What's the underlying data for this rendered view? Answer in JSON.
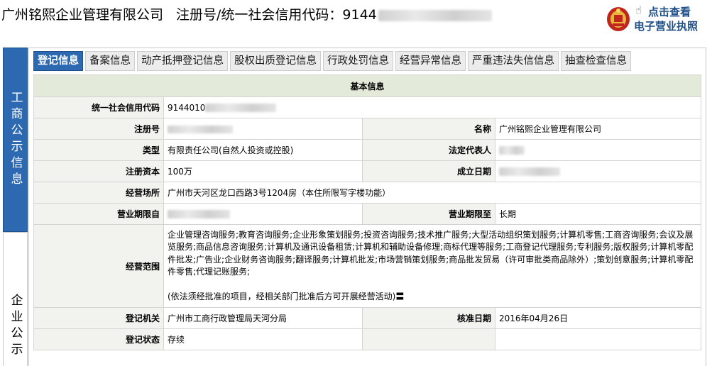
{
  "header": {
    "company_name": "广州铭熙企业管理有限公司",
    "reg_label": "注册号/统一社会信用代码：",
    "reg_prefix": "9144",
    "license_line1": "点击查看",
    "license_line2": "电子营业执照"
  },
  "side_tabs": {
    "active": "工商公示信息",
    "inactive": "企业公示"
  },
  "tabs": [
    "登记信息",
    "备案信息",
    "动产抵押登记信息",
    "股权出质登记信息",
    "行政处罚信息",
    "经营异常信息",
    "严重违法失信信息",
    "抽查检查信息"
  ],
  "basic_info": {
    "section_title": "基本信息",
    "credit_code_label": "统一社会信用代码",
    "credit_code_prefix": "9144010",
    "reg_no_label": "注册号",
    "name_label": "名称",
    "name_value": "广州铭熙企业管理有限公司",
    "type_label": "类型",
    "type_value": "有限责任公司(自然人投资或控股)",
    "legal_rep_label": "法定代表人",
    "capital_label": "注册资本",
    "capital_value": "100万",
    "est_date_label": "成立日期",
    "address_label": "经营场所",
    "address_value": "广州市天河区龙口西路3号1204房（本住所限写字楼功能）",
    "term_from_label": "营业期限自",
    "term_to_label": "营业期限至",
    "term_to_value": "长期",
    "scope_label": "经营范围",
    "scope_value": "企业管理咨询服务;教育咨询服务;企业形象策划服务;投资咨询服务;技术推广服务;大型活动组织策划服务;计算机零售;工商咨询服务;会议及展览服务;商品信息咨询服务;计算机及通讯设备租赁;计算机和辅助设备修理;商标代理等服务;工商登记代理服务;专利服务;版权服务;计算机零配件批发;广告业;企业财务咨询服务;翻译服务;计算机批发;市场营销策划服务;商品批发贸易（许可审批类商品除外）;策划创意服务;计算机零配件零售;代理记账服务;",
    "scope_note": "(依法须经批准的项目，经相关部门批准后方可开展经营活动)〓",
    "authority_label": "登记机关",
    "authority_value": "广州市工商行政管理局天河分局",
    "approval_date_label": "核准日期",
    "approval_date_value": "2016年04月26日",
    "status_label": "登记状态",
    "status_value": "存续"
  },
  "colors": {
    "accent_blue": "#2c69b0",
    "section_bg": "#e3ead9",
    "label_bg": "#f2f3ee",
    "badge_text": "#1f4f86"
  }
}
